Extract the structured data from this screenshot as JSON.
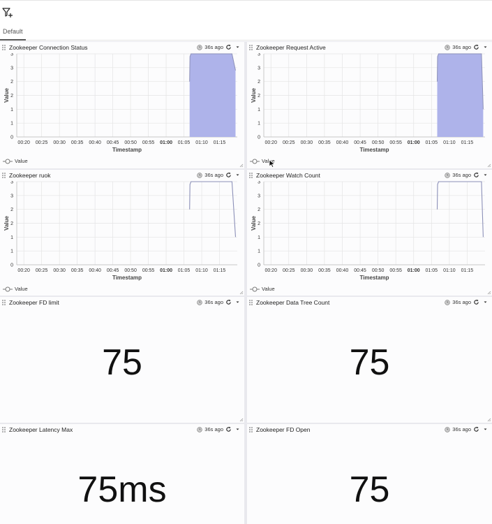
{
  "tabs": [
    {
      "label": "Default",
      "active": true
    }
  ],
  "panels": {
    "conn": {
      "title": "Zookeeper Connection Status",
      "age": "36s ago",
      "legend": "Value"
    },
    "req": {
      "title": "Zookeeper Request Active",
      "age": "36s ago",
      "legend": "Value"
    },
    "ruok": {
      "title": "Zookeeper ruok",
      "age": "36s ago",
      "legend": "Value"
    },
    "watch": {
      "title": "Zookeeper Watch Count",
      "age": "36s ago",
      "legend": "Value"
    },
    "fdlimit": {
      "title": "Zookeeper FD limit",
      "age": "36s ago",
      "value": "75"
    },
    "datatree": {
      "title": "Zookeeper Data Tree Count",
      "age": "36s ago",
      "value": "75"
    },
    "latency": {
      "title": "Zookeeper Latency Max",
      "age": "36s ago",
      "value": "75ms"
    },
    "fdopen": {
      "title": "Zookeeper FD Open",
      "age": "36s ago",
      "value": "75"
    }
  },
  "colors": {
    "area_fill": "#aeb3ea",
    "area_line": "#8c90b8",
    "line": "#8c90b8",
    "grid": "#e4e4e4"
  },
  "chart_data": [
    {
      "id": "conn",
      "type": "area",
      "xlabel": "Timestamp",
      "ylabel": "Value",
      "ylim": [
        0,
        3
      ],
      "yticks": [
        "0",
        "1",
        "1",
        "2",
        "2",
        "3",
        "3"
      ],
      "yticks_values": [
        0,
        0.5,
        1,
        1.5,
        2,
        2.5,
        3
      ],
      "xticks": [
        "00:20",
        "00:25",
        "00:30",
        "00:35",
        "00:40",
        "00:45",
        "00:50",
        "00:55",
        "01:00",
        "01:05",
        "01:10",
        "01:15"
      ],
      "xticks_minutes": [
        20,
        25,
        30,
        35,
        40,
        45,
        50,
        55,
        60,
        65,
        70,
        75
      ],
      "xlim": [
        18,
        80
      ],
      "series": [
        {
          "name": "Value",
          "points": [
            [
              66.6,
              2
            ],
            [
              66.7,
              2.9
            ],
            [
              67,
              3
            ],
            [
              78.5,
              3
            ],
            [
              79.5,
              2.4
            ]
          ]
        }
      ]
    },
    {
      "id": "req",
      "type": "area",
      "xlabel": "Timestamp",
      "ylabel": "Value",
      "ylim": [
        0,
        3
      ],
      "yticks": [
        "0",
        "1",
        "1",
        "2",
        "2",
        "3",
        "3"
      ],
      "yticks_values": [
        0,
        0.5,
        1,
        1.5,
        2,
        2.5,
        3
      ],
      "xticks": [
        "00:20",
        "00:25",
        "00:30",
        "00:35",
        "00:40",
        "00:45",
        "00:50",
        "00:55",
        "01:00",
        "01:05",
        "01:10",
        "01:15"
      ],
      "xticks_minutes": [
        20,
        25,
        30,
        35,
        40,
        45,
        50,
        55,
        60,
        65,
        70,
        75
      ],
      "xlim": [
        18,
        80
      ],
      "series": [
        {
          "name": "Value",
          "points": [
            [
              66.6,
              2
            ],
            [
              66.7,
              2.9
            ],
            [
              67,
              3
            ],
            [
              79,
              3
            ],
            [
              79.5,
              1
            ]
          ]
        }
      ]
    },
    {
      "id": "ruok",
      "type": "line",
      "xlabel": "Timestamp",
      "ylabel": "Value",
      "ylim": [
        0,
        3
      ],
      "yticks": [
        "0",
        "1",
        "1",
        "2",
        "2",
        "3",
        "3"
      ],
      "yticks_values": [
        0,
        0.5,
        1,
        1.5,
        2,
        2.5,
        3
      ],
      "xticks": [
        "00:20",
        "00:25",
        "00:30",
        "00:35",
        "00:40",
        "00:45",
        "00:50",
        "00:55",
        "01:00",
        "01:05",
        "01:10",
        "01:15"
      ],
      "xticks_minutes": [
        20,
        25,
        30,
        35,
        40,
        45,
        50,
        55,
        60,
        65,
        70,
        75
      ],
      "xlim": [
        18,
        80
      ],
      "series": [
        {
          "name": "Value",
          "points": [
            [
              66.6,
              2
            ],
            [
              66.7,
              2.9
            ],
            [
              67,
              3
            ],
            [
              78.5,
              3
            ],
            [
              79.5,
              1
            ]
          ]
        }
      ]
    },
    {
      "id": "watch",
      "type": "line",
      "xlabel": "Timestamp",
      "ylabel": "Value",
      "ylim": [
        0,
        3
      ],
      "yticks": [
        "0",
        "1",
        "1",
        "2",
        "2",
        "3",
        "3"
      ],
      "yticks_values": [
        0,
        0.5,
        1,
        1.5,
        2,
        2.5,
        3
      ],
      "xticks": [
        "00:20",
        "00:25",
        "00:30",
        "00:35",
        "00:40",
        "00:45",
        "00:50",
        "00:55",
        "01:00",
        "01:05",
        "01:10",
        "01:15"
      ],
      "xticks_minutes": [
        20,
        25,
        30,
        35,
        40,
        45,
        50,
        55,
        60,
        65,
        70,
        75
      ],
      "xlim": [
        18,
        80
      ],
      "series": [
        {
          "name": "Value",
          "points": [
            [
              66.6,
              2
            ],
            [
              66.7,
              2.9
            ],
            [
              67,
              3
            ],
            [
              79,
              3
            ],
            [
              79.5,
              1
            ]
          ]
        }
      ]
    }
  ]
}
